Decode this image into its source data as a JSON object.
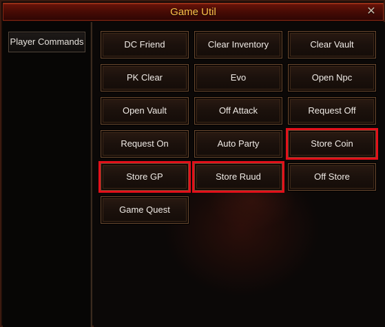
{
  "window": {
    "title": "Game Util",
    "close_glyph": "✕"
  },
  "sidebar": {
    "items": [
      {
        "label": "Player Commands"
      }
    ]
  },
  "commands": [
    {
      "label": "DC Friend"
    },
    {
      "label": "Clear Inventory"
    },
    {
      "label": "Clear Vault"
    },
    {
      "label": "PK Clear"
    },
    {
      "label": "Evo"
    },
    {
      "label": "Open Npc"
    },
    {
      "label": "Open Vault"
    },
    {
      "label": "Off Attack"
    },
    {
      "label": "Request Off"
    },
    {
      "label": "Request On"
    },
    {
      "label": "Auto Party"
    },
    {
      "label": "Store Coin",
      "highlighted": true
    },
    {
      "label": "Store GP",
      "highlighted": true
    },
    {
      "label": "Store Ruud",
      "highlighted": true
    },
    {
      "label": "Off Store"
    },
    {
      "label": "Game Quest"
    }
  ],
  "colors": {
    "title_text": "#ffc24a",
    "titlebar": "#4a0c05",
    "button_text": "#f0ebe6",
    "highlight_outline": "#e3101a"
  }
}
